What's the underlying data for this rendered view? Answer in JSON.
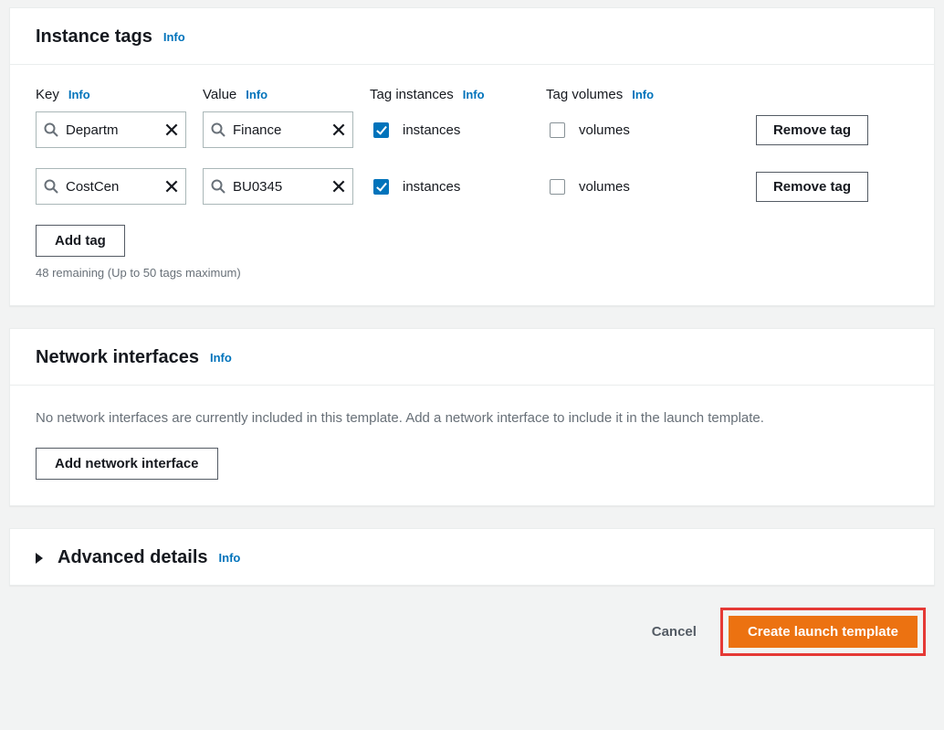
{
  "common": {
    "info_label": "Info"
  },
  "instance_tags": {
    "title": "Instance tags",
    "columns": {
      "key": "Key",
      "value": "Value",
      "tag_instances": "Tag instances",
      "tag_volumes": "Tag volumes"
    },
    "cbx_labels": {
      "instances": "instances",
      "volumes": "volumes"
    },
    "rows": [
      {
        "key": "Departm",
        "value": "Finance",
        "tag_instances": true,
        "tag_volumes": false
      },
      {
        "key": "CostCen",
        "value": "BU0345",
        "tag_instances": true,
        "tag_volumes": false
      }
    ],
    "remove_label": "Remove tag",
    "add_label": "Add tag",
    "helper": "48 remaining (Up to 50 tags maximum)"
  },
  "network_interfaces": {
    "title": "Network interfaces",
    "text": "No network interfaces are currently included in this template. Add a network interface to include it in the launch template.",
    "add_label": "Add network interface"
  },
  "advanced": {
    "title": "Advanced details"
  },
  "footer": {
    "cancel": "Cancel",
    "create": "Create launch template"
  }
}
